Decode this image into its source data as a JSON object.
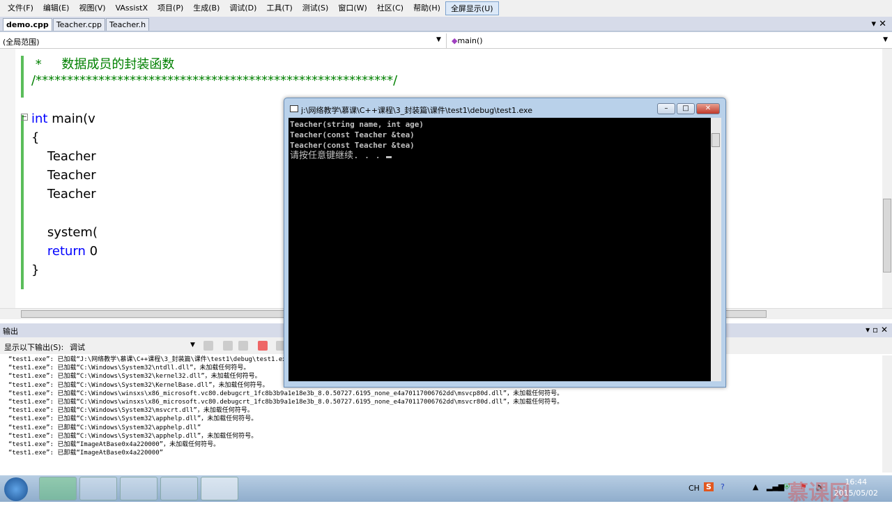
{
  "menu": [
    "文件(F)",
    "编辑(E)",
    "视图(V)",
    "VAssistX",
    "项目(P)",
    "生成(B)",
    "调试(D)",
    "工具(T)",
    "测试(S)",
    "窗口(W)",
    "社区(C)",
    "帮助(H)",
    "全屏显示(U)"
  ],
  "tabs": [
    "demo.cpp",
    "Teacher.cpp",
    "Teacher.h"
  ],
  "scope": {
    "left": "(全局范围)",
    "right": "main()"
  },
  "code": {
    "l1": " *     数据成员的封装函数",
    "l2": "/*********************************************************/",
    "l3_kw": "int",
    "l3": " main(v",
    "l4": "{",
    "l5": "    Teacher",
    "l6": "    Teacher",
    "l7": "    Teacher",
    "l8": "    system(",
    "l9_kw": "return",
    "l9": " 0",
    "l10": "}"
  },
  "output": {
    "title": "输出",
    "show_label": "显示以下输出(S):",
    "show_value": "调试",
    "lines": [
      "“test1.exe”: 已加载“J:\\网络教学\\慕课\\C++课程\\3_封装篇\\课件\\test1\\debug\\test1.exe”，已加载符号。",
      "“test1.exe”: 已加载“C:\\Windows\\System32\\ntdll.dll”，未加载任何符号。",
      "“test1.exe”: 已加载“C:\\Windows\\System32\\kernel32.dll”，未加载任何符号。",
      "“test1.exe”: 已加载“C:\\Windows\\System32\\KernelBase.dll”，未加载任何符号。",
      "“test1.exe”: 已加载“C:\\Windows\\winsxs\\x86_microsoft.vc80.debugcrt_1fc8b3b9a1e18e3b_8.0.50727.6195_none_e4a70117006762dd\\msvcp80d.dll”，未加载任何符号。",
      "“test1.exe”: 已加载“C:\\Windows\\winsxs\\x86_microsoft.vc80.debugcrt_1fc8b3b9a1e18e3b_8.0.50727.6195_none_e4a70117006762dd\\msvcr80d.dll”，未加载任何符号。",
      "“test1.exe”: 已加载“C:\\Windows\\System32\\msvcrt.dll”，未加载任何符号。",
      "“test1.exe”: 已加载“C:\\Windows\\System32\\apphelp.dll”，未加载任何符号。",
      "“test1.exe”: 已卸载“C:\\Windows\\System32\\apphelp.dll”",
      "“test1.exe”: 已加载“C:\\Windows\\System32\\apphelp.dll”，未加载任何符号。",
      "“test1.exe”: 已加载“ImageAtBase0x4a220000”，未加载任何符号。",
      "“test1.exe”: 已卸载“ImageAtBase0x4a220000”"
    ]
  },
  "console": {
    "title": "j:\\网络教学\\慕课\\C++课程\\3_封装篇\\课件\\test1\\debug\\test1.exe",
    "lines": [
      "Teacher(string name, int age)",
      "Teacher(const Teacher &tea)",
      "Teacher(const Teacher &tea)",
      "请按任意键继续. . . "
    ]
  },
  "tray": {
    "lang": "CH",
    "time": "16:44",
    "date": "2015/05/02",
    "watermark": "慕课网"
  }
}
